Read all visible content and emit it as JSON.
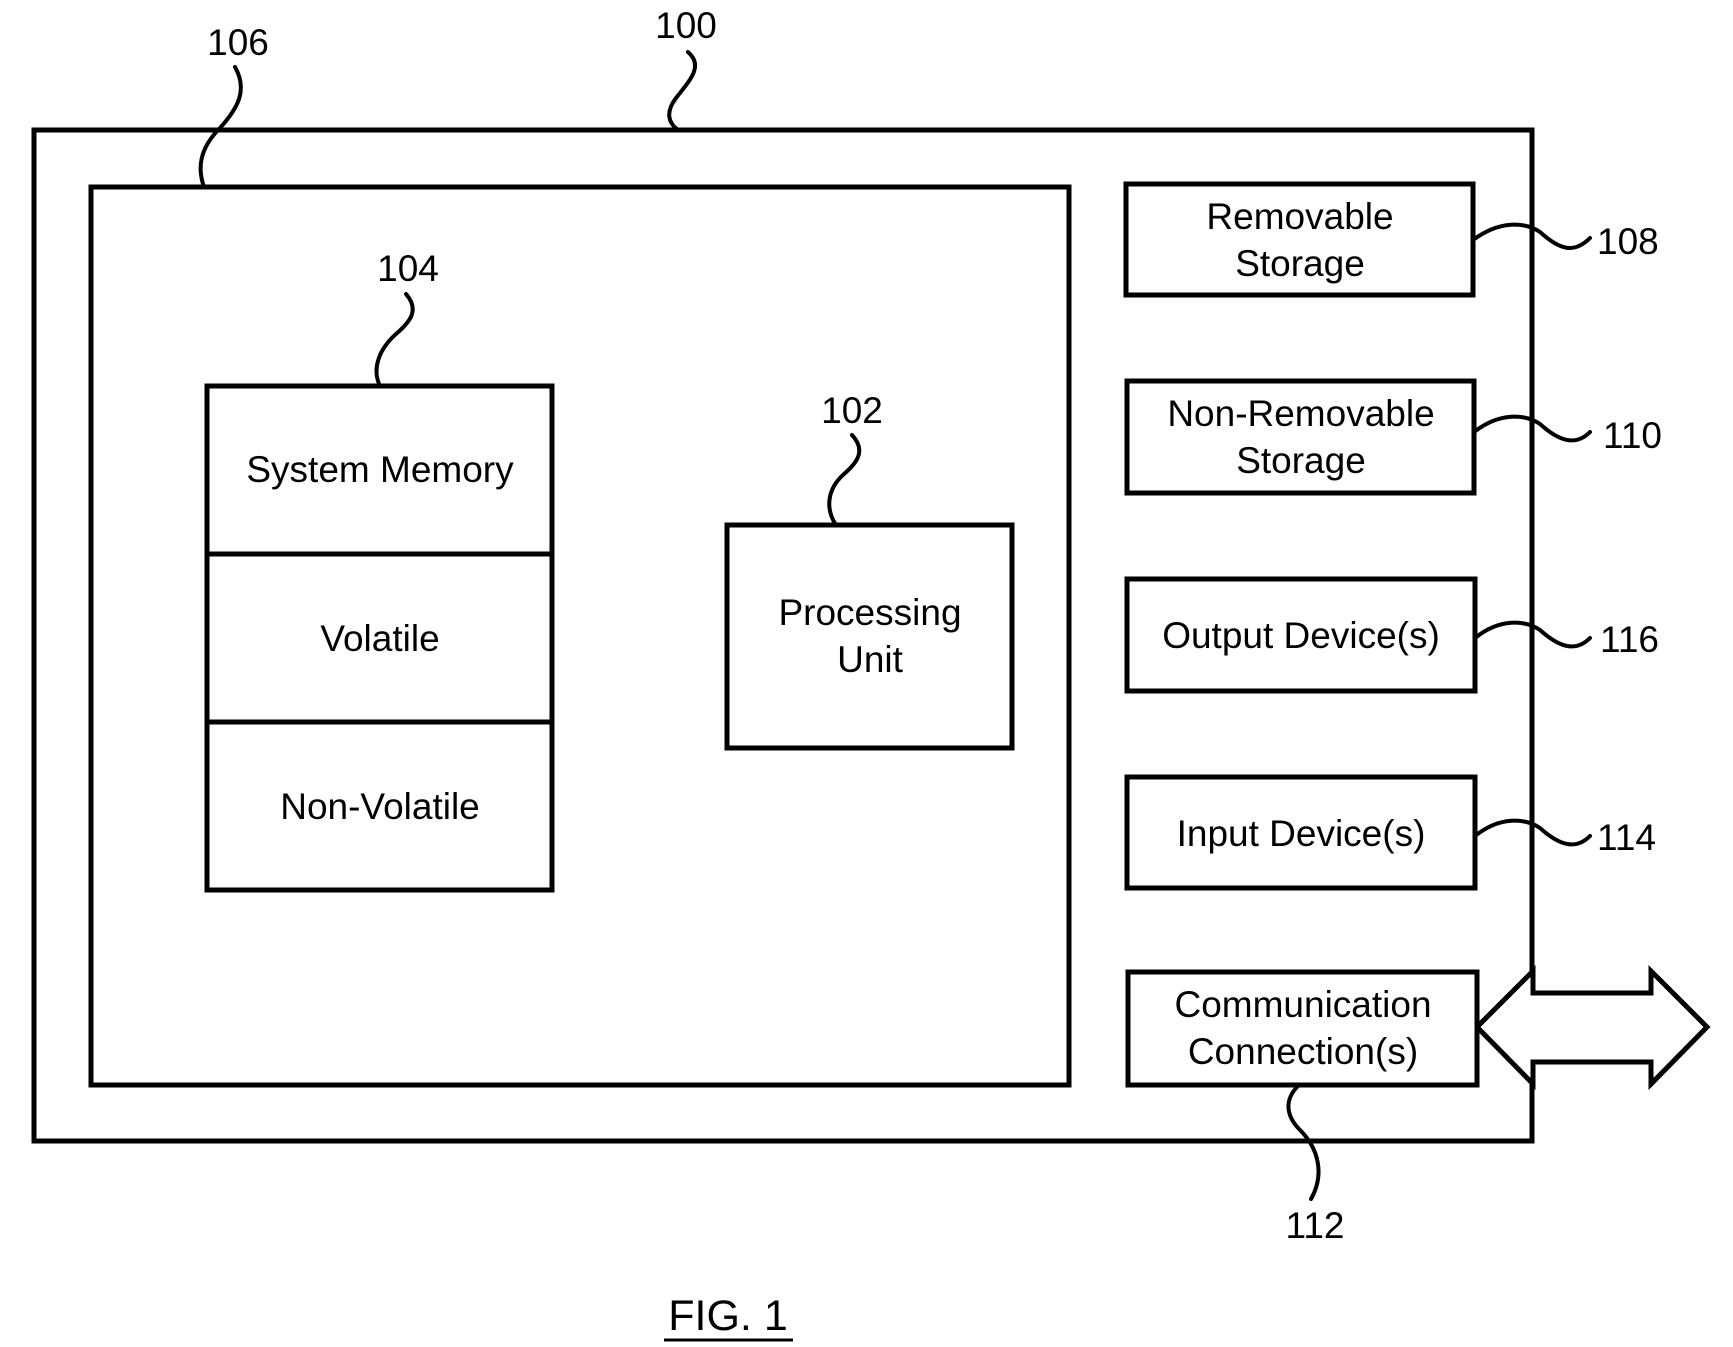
{
  "figure": {
    "caption": "FIG. 1",
    "colors": {
      "line": "#000000",
      "background": "#ffffff"
    }
  },
  "device": {
    "ref": "100",
    "basic_config": {
      "ref": "106",
      "system_memory": {
        "ref": "104",
        "cells": [
          "System Memory",
          "Volatile",
          "Non-Volatile"
        ]
      },
      "processing_unit": {
        "ref": "102",
        "lines": [
          "Processing",
          "Unit"
        ]
      }
    },
    "components": [
      {
        "id": "removable-storage",
        "ref": "108",
        "lines": [
          "Removable",
          "Storage"
        ]
      },
      {
        "id": "non-removable-storage",
        "ref": "110",
        "lines": [
          "Non-Removable",
          "Storage"
        ]
      },
      {
        "id": "output-devices",
        "ref": "116",
        "lines": [
          "Output Device(s)"
        ]
      },
      {
        "id": "input-devices",
        "ref": "114",
        "lines": [
          "Input Device(s)"
        ]
      },
      {
        "id": "communication-connections",
        "ref": "112",
        "lines": [
          "Communication",
          "Connection(s)"
        ]
      }
    ]
  }
}
